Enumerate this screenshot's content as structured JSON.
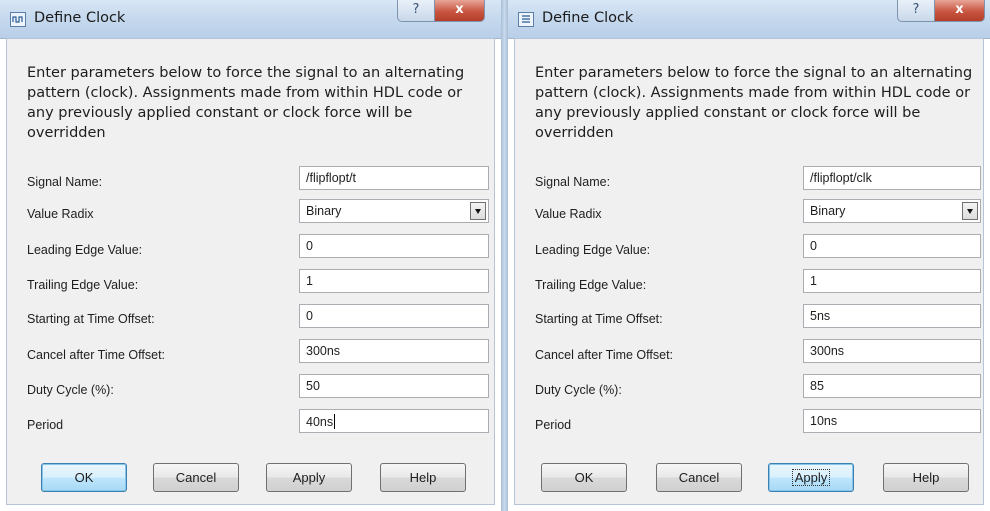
{
  "dialogs": [
    {
      "title": "Define Clock",
      "title_buttons": {
        "help": "?",
        "close": "x"
      },
      "description": "Enter parameters below to force the signal to an alternating pattern (clock). Assignments made from within HDL code or any previously applied constant or clock force will be overridden",
      "fields": [
        {
          "label": "Signal Name:",
          "value": "/flipflopt/t"
        },
        {
          "label": "Value Radix",
          "value": "Binary"
        },
        {
          "label": "Leading Edge Value:",
          "value": "0"
        },
        {
          "label": "Trailing Edge Value:",
          "value": "1"
        },
        {
          "label": "Starting at Time Offset:",
          "value": "0"
        },
        {
          "label": "Cancel after Time Offset:",
          "value": "300ns"
        },
        {
          "label": "Duty Cycle (%):",
          "value": "50"
        },
        {
          "label": "Period",
          "value": "40ns"
        }
      ],
      "buttons": {
        "ok": "OK",
        "cancel": "Cancel",
        "apply": "Apply",
        "help": "Help"
      }
    },
    {
      "title": "Define Clock",
      "title_buttons": {
        "help": "?",
        "close": "x"
      },
      "description": "Enter parameters below to force the signal to an alternating pattern (clock). Assignments made from within HDL code or any previously applied constant or clock force will be overridden",
      "fields": [
        {
          "label": "Signal Name:",
          "value": "/flipflopt/clk"
        },
        {
          "label": "Value Radix",
          "value": "Binary"
        },
        {
          "label": "Leading Edge Value:",
          "value": "0"
        },
        {
          "label": "Trailing Edge Value:",
          "value": "1"
        },
        {
          "label": "Starting at Time Offset:",
          "value": "5ns"
        },
        {
          "label": "Cancel after Time Offset:",
          "value": "300ns"
        },
        {
          "label": "Duty Cycle (%):",
          "value": "85"
        },
        {
          "label": "Period",
          "value": "10ns"
        }
      ],
      "buttons": {
        "ok": "OK",
        "cancel": "Cancel",
        "apply": "Apply",
        "help": "Help"
      }
    }
  ]
}
